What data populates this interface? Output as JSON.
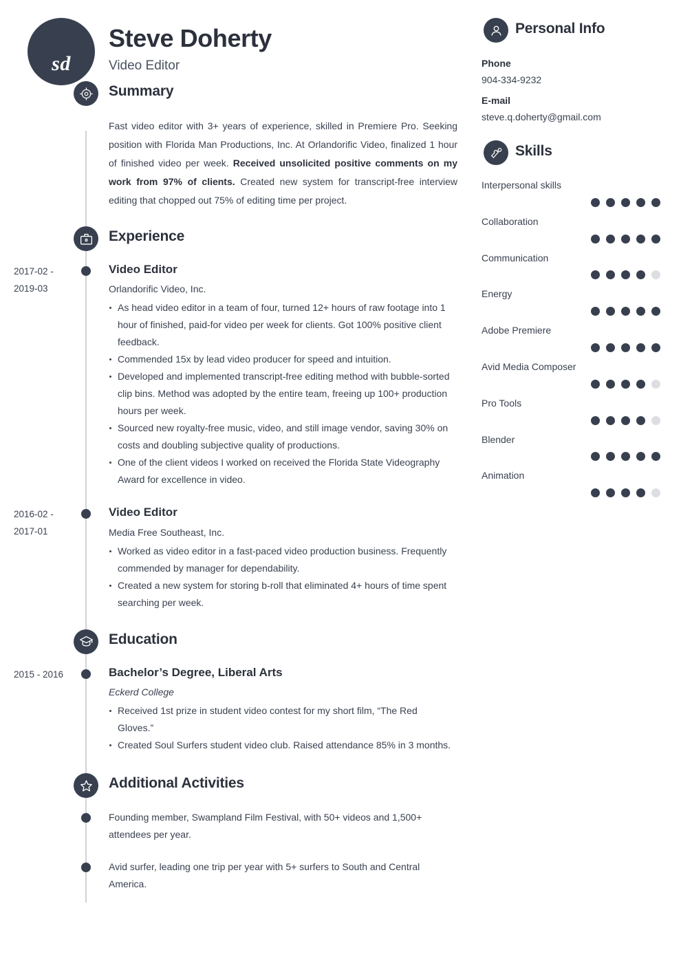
{
  "header": {
    "initials": "sd",
    "name": "Steve Doherty",
    "job_title": "Video Editor"
  },
  "colors": {
    "dark": "#38404f",
    "text": "#3a4150",
    "dot_off": "#dcdee1",
    "timeline": "#cfd2d7"
  },
  "summary": {
    "icon": "target-icon",
    "title": "Summary",
    "text_before": "Fast video editor with 3+ years of experience, skilled in Premiere Pro. Seeking position with Florida Man Productions, Inc. At Orlandorific Video, finalized 1 hour of finished video per week. ",
    "text_bold": "Received unsolicited positive comments on my work from 97% of clients.",
    "text_after": " Created new system for transcript-free interview editing that chopped out 75% of editing time per project."
  },
  "experience": {
    "icon": "briefcase-icon",
    "title": "Experience",
    "entries": [
      {
        "dates": "2017-02 - 2019-03",
        "role": "Video Editor",
        "org": "Orlandorific Video, Inc.",
        "bullets": [
          "As head video editor in a team of four, turned 12+ hours of raw footage into 1 hour of finished, paid-for video per week for clients. Got 100% positive client feedback.",
          "Commended 15x by lead video producer for speed and intuition.",
          "Developed and implemented transcript-free editing method with bubble-sorted clip bins. Method was adopted by the entire team, freeing up 100+ production hours per week.",
          "Sourced new royalty-free music, video, and still image vendor, saving 30% on costs and doubling subjective quality of productions.",
          "One of the client videos I worked on received the Florida State Videography Award for excellence in video."
        ]
      },
      {
        "dates": "2016-02 - 2017-01",
        "role": "Video Editor",
        "org": "Media Free Southeast, Inc.",
        "bullets": [
          "Worked as video editor in a fast-paced video production business. Frequently commended by manager for dependability.",
          "Created a new system for storing b-roll that eliminated 4+ hours of time spent searching per week."
        ]
      }
    ]
  },
  "education": {
    "icon": "graduation-cap-icon",
    "title": "Education",
    "entries": [
      {
        "dates": "2015 - 2016",
        "role": "Bachelor’s Degree, Liberal Arts",
        "org": "Eckerd College",
        "bullets": [
          "Received 1st prize in student video contest for my short film, “The Red Gloves.”",
          "Created Soul Surfers student video club. Raised attendance 85% in 3 months."
        ]
      }
    ]
  },
  "activities": {
    "icon": "star-icon",
    "title": "Additional Activities",
    "entries": [
      "Founding member, Swampland Film Festival, with 50+ videos and 1,500+ attendees per year.",
      "Avid surfer, leading one trip per year with 5+ surfers to South and Central America."
    ]
  },
  "personal_info": {
    "icon": "person-icon",
    "title": "Personal Info",
    "fields": [
      {
        "label": "Phone",
        "value": "904-334-9232"
      },
      {
        "label": "E-mail",
        "value": "steve.q.doherty@gmail.com"
      }
    ]
  },
  "skills": {
    "icon": "puzzle-piece-icon",
    "title": "Skills",
    "max_rating": 5,
    "items": [
      {
        "name": "Interpersonal skills",
        "rating": 5
      },
      {
        "name": "Collaboration",
        "rating": 5
      },
      {
        "name": "Communication",
        "rating": 4
      },
      {
        "name": "Energy",
        "rating": 5
      },
      {
        "name": "Adobe Premiere",
        "rating": 5
      },
      {
        "name": "Avid Media Composer",
        "rating": 4
      },
      {
        "name": "Pro Tools",
        "rating": 4
      },
      {
        "name": "Blender",
        "rating": 5
      },
      {
        "name": "Animation",
        "rating": 4
      }
    ]
  }
}
